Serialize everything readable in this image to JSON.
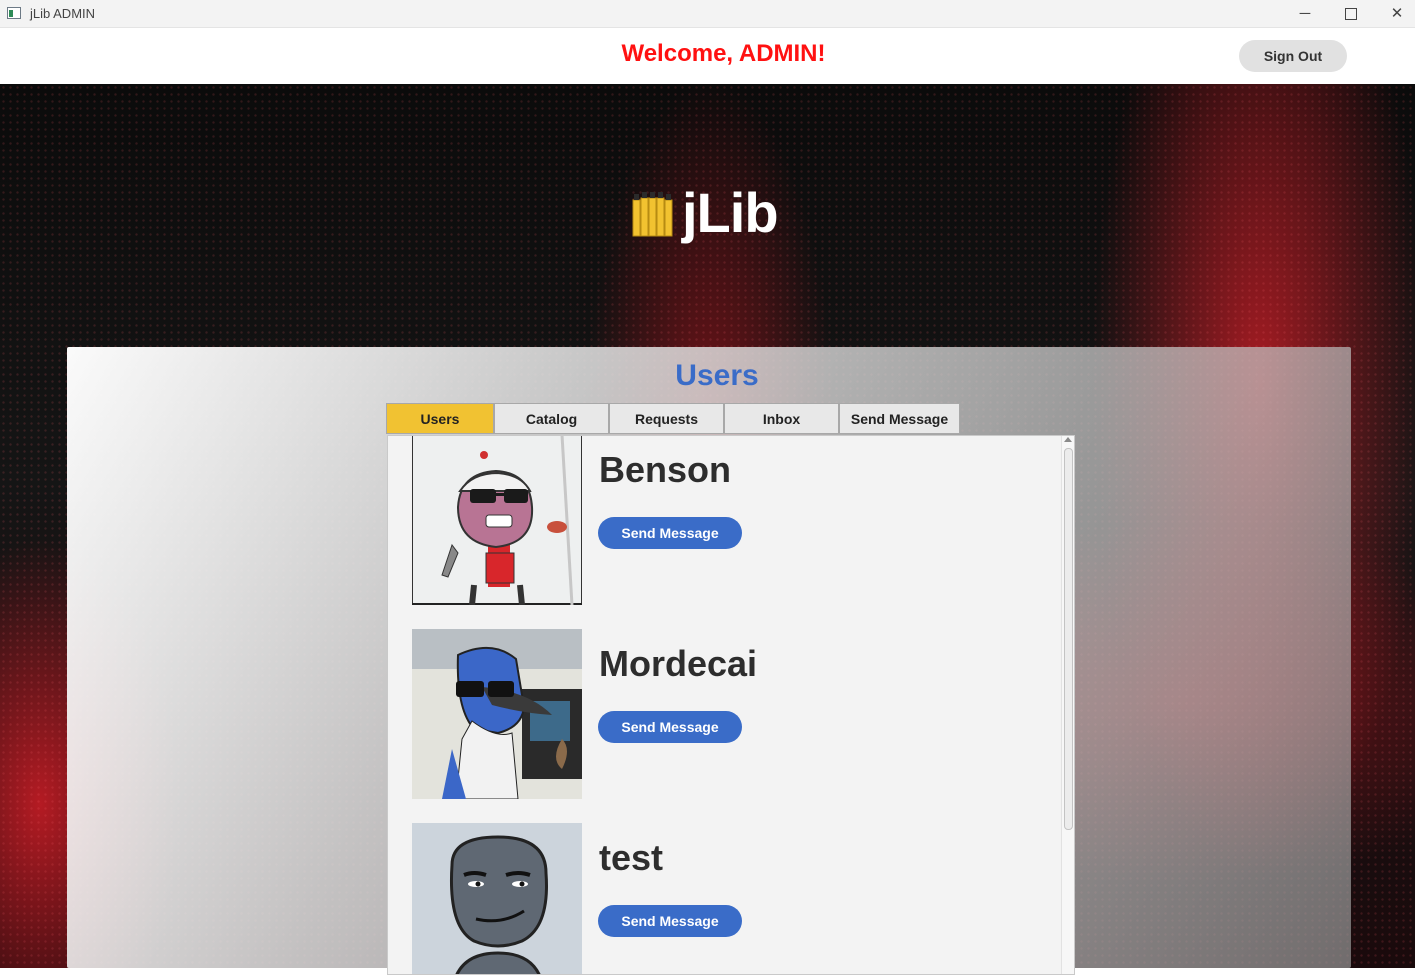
{
  "window": {
    "title": "jLib ADMIN",
    "min": "─",
    "close": "✕"
  },
  "header": {
    "welcome": "Welcome, ADMIN!",
    "signout": "Sign Out"
  },
  "logo": {
    "text": "jLib"
  },
  "panel": {
    "title": "Users",
    "tabs": [
      "Users",
      "Catalog",
      "Requests",
      "Inbox",
      "Send Message"
    ],
    "active_tab": "Users"
  },
  "users": [
    {
      "name": "Benson",
      "button": "Send Message"
    },
    {
      "name": "Mordecai",
      "button": "Send Message"
    },
    {
      "name": "test",
      "button": "Send Message"
    }
  ],
  "colors": {
    "accent": "#3a6cc8",
    "welcome": "#ff1111",
    "active_tab": "#f1c232",
    "logo_books": "#f2c230"
  }
}
